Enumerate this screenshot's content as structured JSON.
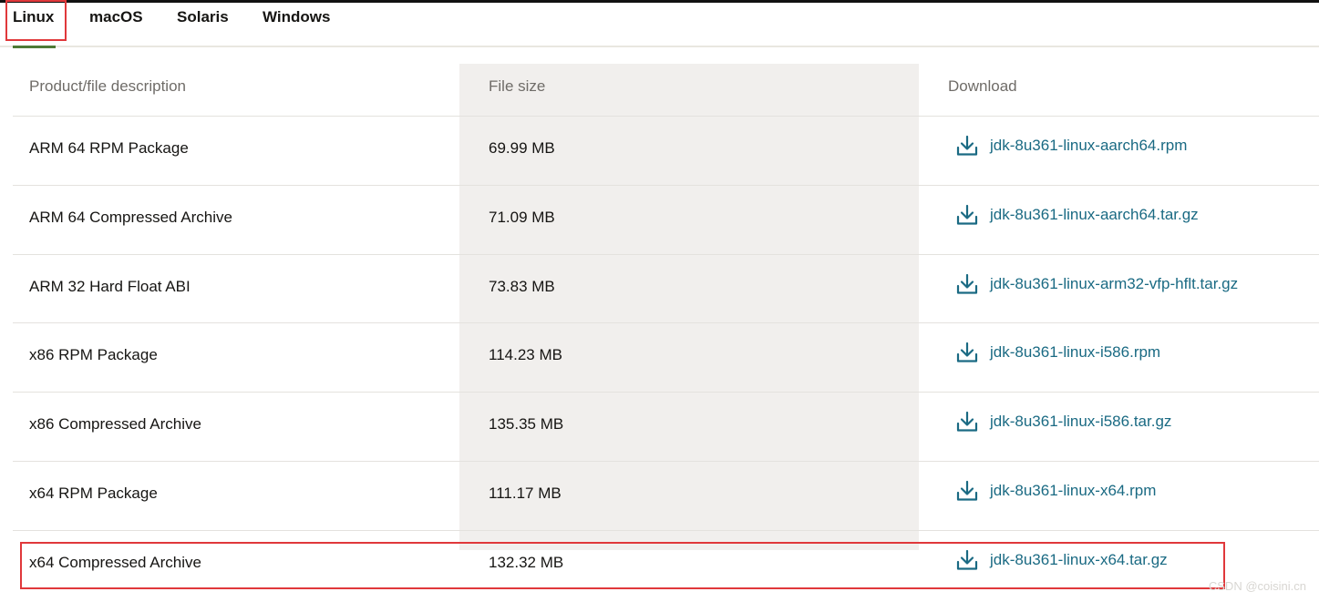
{
  "tabs": [
    {
      "label": "Linux",
      "active": true
    },
    {
      "label": "macOS",
      "active": false
    },
    {
      "label": "Solaris",
      "active": false
    },
    {
      "label": "Windows",
      "active": false
    }
  ],
  "table": {
    "headers": {
      "description": "Product/file description",
      "size": "File size",
      "download": "Download"
    },
    "rows": [
      {
        "description": "ARM 64 RPM Package",
        "size": "69.99 MB",
        "file": "jdk-8u361-linux-aarch64.rpm"
      },
      {
        "description": "ARM 64 Compressed Archive",
        "size": "71.09 MB",
        "file": "jdk-8u361-linux-aarch64.tar.gz"
      },
      {
        "description": "ARM 32 Hard Float ABI",
        "size": "73.83 MB",
        "file": "jdk-8u361-linux-arm32-vfp-hflt.tar.gz"
      },
      {
        "description": "x86 RPM Package",
        "size": "114.23 MB",
        "file": "jdk-8u361-linux-i586.rpm"
      },
      {
        "description": "x86 Compressed Archive",
        "size": "135.35 MB",
        "file": "jdk-8u361-linux-i586.tar.gz"
      },
      {
        "description": "x64 RPM Package",
        "size": "111.17 MB",
        "file": "jdk-8u361-linux-x64.rpm"
      },
      {
        "description": "x64 Compressed Archive",
        "size": "132.32 MB",
        "file": "jdk-8u361-linux-x64.tar.gz"
      }
    ]
  },
  "colors": {
    "link": "#1a6a83",
    "highlight": "#e0383b",
    "active_tab_underline": "#4d7a35",
    "size_column_bg": "#f1efed"
  },
  "icons": {
    "download": "download-icon"
  },
  "watermark": "CSDN @coisini.cn"
}
